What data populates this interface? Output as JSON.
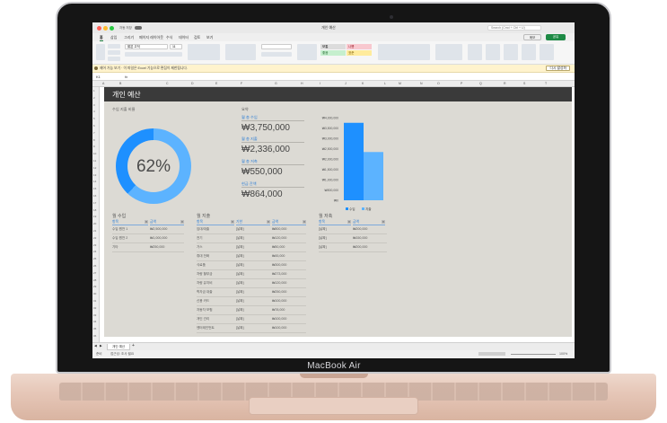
{
  "device": {
    "brand_label": "MacBook Air"
  },
  "window": {
    "title": "개인 예산",
    "autosave_label": "자동 저장",
    "search_placeholder": "Search (Cmd + Ctrl + U)",
    "comment_label": "메모",
    "share_label": "공유"
  },
  "ribbon_tabs": [
    "홈",
    "삽입",
    "그리기",
    "페이지 레이아웃",
    "수식",
    "데이터",
    "검토",
    "보기"
  ],
  "ribbon": {
    "font_name": "맑은 고딕",
    "font_size": "11",
    "styles": [
      "보통",
      "나쁨",
      "좋음",
      "표준"
    ]
  },
  "infobar": {
    "text": "제어 가능 보기 · 이 파일은 Excel 기능으로 편집이 제한됩니다.",
    "button": "다시 활성화"
  },
  "formula_bar": {
    "cell_ref": "K1",
    "fx": "fx"
  },
  "columns": [
    "A",
    "B",
    "C",
    "D",
    "E",
    "F",
    "G",
    "H",
    "I",
    "J",
    "K",
    "L",
    "M",
    "N",
    "O",
    "P",
    "Q",
    "R",
    "S",
    "T"
  ],
  "rows": [
    "1",
    "2",
    "3",
    "4",
    "5",
    "6",
    "7",
    "8",
    "9",
    "10",
    "11",
    "12",
    "13",
    "14",
    "15",
    "16",
    "17",
    "18",
    "19",
    "20",
    "21",
    "22",
    "23",
    "24",
    "25",
    "26",
    "27",
    "28",
    "29",
    "30",
    "31",
    "32",
    "33",
    "34",
    "35",
    "36"
  ],
  "sheet": {
    "title": "개인 예산",
    "ratio_label": "수입 지출 비율",
    "ratio_pct": "62%",
    "ratio_value": 0.62,
    "summary": {
      "heading": "요약",
      "items": [
        {
          "label": "월 총 수입",
          "value": "₩3,750,000"
        },
        {
          "label": "월 총 지출",
          "value": "₩2,336,000"
        },
        {
          "label": "월 총 저축",
          "value": "₩550,000"
        },
        {
          "label": "현금 잔액",
          "value": "₩864,000"
        }
      ]
    },
    "income": {
      "title": "월 수입",
      "headers": [
        "항목",
        "금액"
      ],
      "rows": [
        [
          "수입 원천 1",
          "₩2,500,000"
        ],
        [
          "수입 원천 2",
          "₩1,000,000"
        ],
        [
          "기타",
          "₩250,000"
        ]
      ]
    },
    "expenses": {
      "title": "월 지출",
      "headers": [
        "항목",
        "기한",
        "금액"
      ],
      "rows": [
        [
          "임대/대출",
          "[날짜]",
          "₩800,000"
        ],
        [
          "전기",
          "[날짜]",
          "₩120,000"
        ],
        [
          "가스",
          "[날짜]",
          "₩50,000"
        ],
        [
          "휴대 전화",
          "[날짜]",
          "₩45,000"
        ],
        [
          "식료품",
          "[날짜]",
          "₩300,000"
        ],
        [
          "차량 할부금",
          "[날짜]",
          "₩273,000"
        ],
        [
          "차량 유지비",
          "[날짜]",
          "₩120,000"
        ],
        [
          "학자금 대출",
          "[날짜]",
          "₩250,000"
        ],
        [
          "신용 카드",
          "[날짜]",
          "₩100,000"
        ],
        [
          "자동차 보험",
          "[날짜]",
          "₩78,000"
        ],
        [
          "개인 관리",
          "[날짜]",
          "₩100,000"
        ],
        [
          "엔터테인먼트",
          "[날짜]",
          "₩100,000"
        ]
      ]
    },
    "savings": {
      "title": "월 저축",
      "headers": [
        "항목",
        "금액"
      ],
      "rows": [
        [
          "[날짜]",
          "₩200,000"
        ],
        [
          "[날짜]",
          "₩150,000"
        ],
        [
          "[날짜]",
          "₩200,000"
        ]
      ]
    }
  },
  "chart_data": {
    "type": "bar",
    "categories": [
      ""
    ],
    "series": [
      {
        "name": "수입",
        "values": [
          3750000
        ],
        "color": "#1e90ff"
      },
      {
        "name": "지출",
        "values": [
          2336000
        ],
        "color": "#5cb3ff"
      }
    ],
    "y_ticks": [
      "₩4,000,000",
      "₩3,500,000",
      "₩3,000,000",
      "₩2,500,000",
      "₩2,000,000",
      "₩1,500,000",
      "₩1,000,000",
      "₩500,000",
      "₩0"
    ],
    "ylim": [
      0,
      4000000
    ],
    "legend_position": "bottom"
  },
  "status": {
    "ready": "준비",
    "accessibility": "접근성: 조사 필요",
    "zoom": "100%",
    "sheet_tab": "개인 예산"
  },
  "colors": {
    "income": "#1e90ff",
    "expense": "#5cb3ff",
    "banner": "#3a3a3a",
    "accent": "#1e8a45"
  }
}
